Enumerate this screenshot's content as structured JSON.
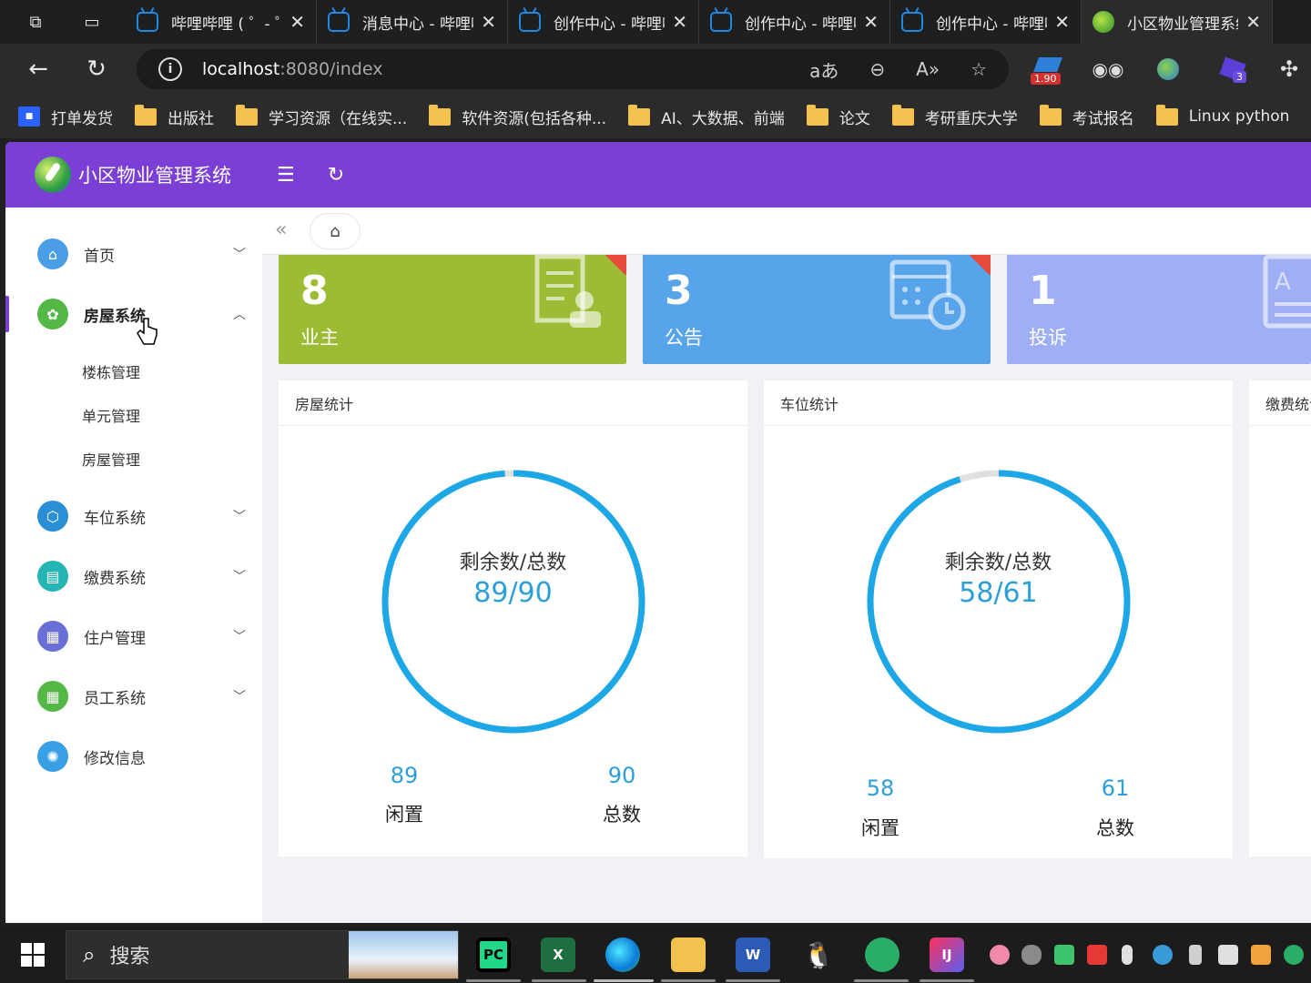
{
  "browser": {
    "tabs": [
      {
        "title": "哔哩哔哩 ( ゜- ゜)",
        "favicon": "bilibili-icon"
      },
      {
        "title": "消息中心 - 哔哩哔哩",
        "favicon": "bilibili-icon"
      },
      {
        "title": "创作中心 - 哔哩哔哩",
        "favicon": "bilibili-icon"
      },
      {
        "title": "创作中心 - 哔哩哔哩",
        "favicon": "bilibili-icon"
      },
      {
        "title": "创作中心 - 哔哩哔哩",
        "favicon": "bilibili-icon"
      },
      {
        "title": "小区物业管理系统",
        "favicon": "rocket-icon"
      }
    ],
    "close_glyph": "✕",
    "url": {
      "host": "localhost",
      "path": ":8080/index"
    },
    "ext_badges": {
      "speed": "1.90",
      "count": "3"
    },
    "bookmarks": [
      "打单发货",
      "出版社",
      "学习资源（在线实...",
      "软件资源(包括各种...",
      "AI、大数据、前端",
      "论文",
      "考研重庆大学",
      "考试报名",
      "Linux python"
    ]
  },
  "app": {
    "title": "小区物业管理系统",
    "accent": "#7b3fd6",
    "sidebar": {
      "items": [
        {
          "label": "首页",
          "icon": "home-icon",
          "color": "#4a9ee6",
          "expanded": false
        },
        {
          "label": "房屋系统",
          "icon": "gear-icon",
          "color": "#54b846",
          "expanded": true
        },
        {
          "label": "车位系统",
          "icon": "cube-icon",
          "color": "#2a8fd4",
          "expanded": false
        },
        {
          "label": "缴费系统",
          "icon": "book-icon",
          "color": "#26b5b5",
          "expanded": false
        },
        {
          "label": "住户管理",
          "icon": "apps-icon",
          "color": "#6a6fd6",
          "expanded": false
        },
        {
          "label": "员工系统",
          "icon": "apps-icon",
          "color": "#54b846",
          "expanded": false
        },
        {
          "label": "修改信息",
          "icon": "settings-icon",
          "color": "#3aa0e6",
          "expanded": false
        }
      ],
      "sub_items": [
        "楼栋管理",
        "单元管理",
        "房屋管理"
      ]
    },
    "stats": [
      {
        "value": "8",
        "label": "业主",
        "color": "#9cbc35"
      },
      {
        "value": "3",
        "label": "公告",
        "color": "#57a4ea"
      },
      {
        "value": "1",
        "label": "投诉",
        "color": "#9eaff6"
      }
    ],
    "panels": [
      {
        "title": "房屋统计",
        "ring_label": "剩余数/总数",
        "ring_value": "89/90",
        "free": 89,
        "total": 90,
        "free_label": "闲置",
        "total_label": "总数"
      },
      {
        "title": "车位统计",
        "ring_label": "剩余数/总数",
        "ring_value": "58/61",
        "free": 58,
        "total": 61,
        "free_label": "闲置",
        "total_label": "总数"
      },
      {
        "title": "缴费统计"
      }
    ]
  },
  "taskbar": {
    "search_placeholder": "搜索",
    "apps": [
      "pycharm-icon",
      "excel-icon",
      "edge-icon",
      "explorer-icon",
      "word-icon",
      "qq-icon",
      "wechat-icon",
      "intellij-icon"
    ]
  }
}
